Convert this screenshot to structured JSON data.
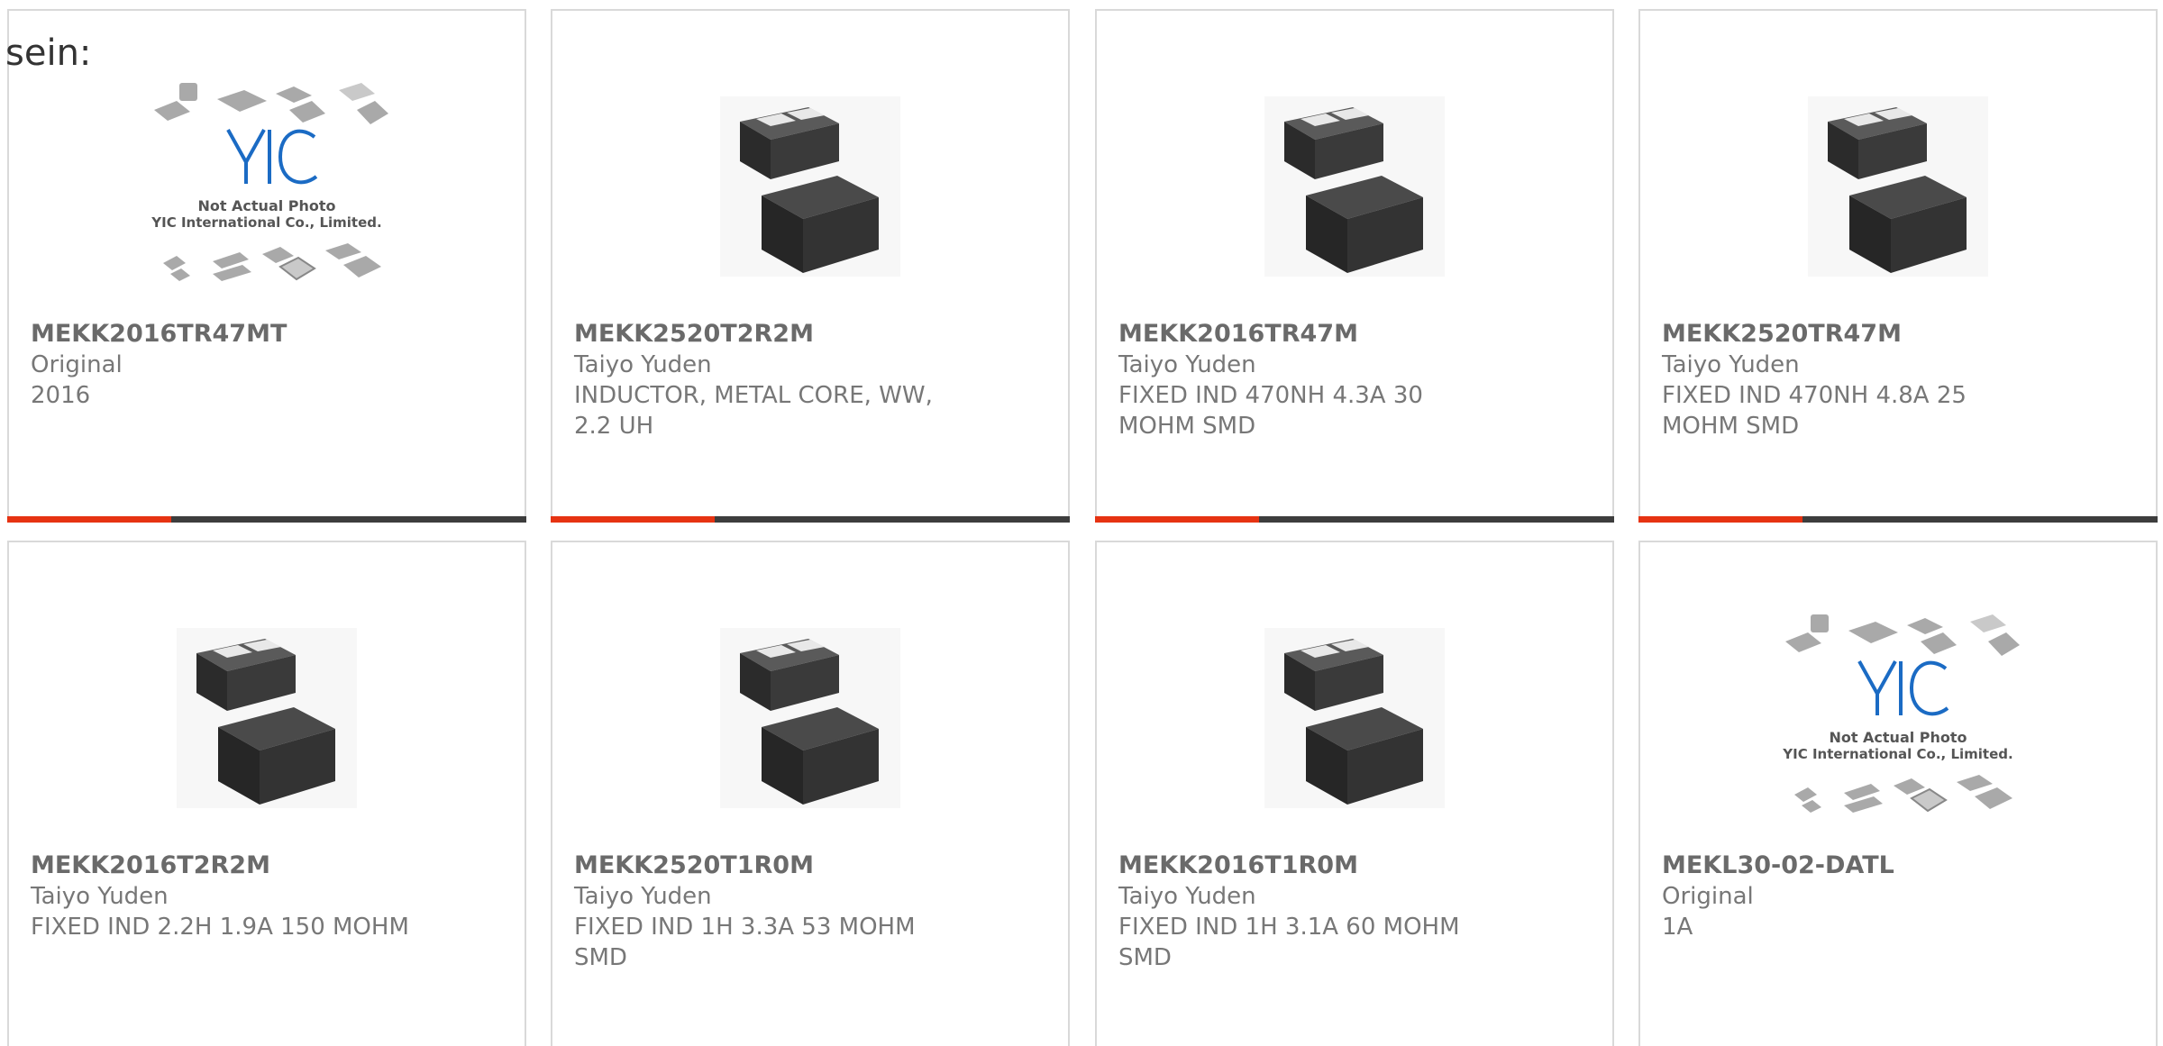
{
  "intro_text": "sein:",
  "colors": {
    "accent": "#e63312",
    "bar": "#3d3d3d"
  },
  "placeholder": {
    "line1": "Not Actual Photo",
    "line2": "YIC International Co., Limited.",
    "logo": "YIC"
  },
  "products": [
    {
      "part": "MEKK2016TR47MT",
      "maker": "Original",
      "desc": "2016",
      "image": "placeholder"
    },
    {
      "part": "MEKK2520T2R2M",
      "maker": "Taiyo Yuden",
      "desc": "INDUCTOR, METAL CORE, WW, 2.2 UH",
      "image": "inductor"
    },
    {
      "part": "MEKK2016TR47M",
      "maker": "Taiyo Yuden",
      "desc": "FIXED IND 470NH 4.3A 30 MOHM SMD",
      "image": "inductor"
    },
    {
      "part": "MEKK2520TR47M",
      "maker": "Taiyo Yuden",
      "desc": "FIXED IND 470NH 4.8A 25 MOHM SMD",
      "image": "inductor"
    },
    {
      "part": "MEKK2016T2R2M",
      "maker": "Taiyo Yuden",
      "desc": "FIXED IND 2.2H 1.9A 150 MOHM",
      "image": "inductor"
    },
    {
      "part": "MEKK2520T1R0M",
      "maker": "Taiyo Yuden",
      "desc": "FIXED IND 1H 3.3A 53 MOHM SMD",
      "image": "inductor"
    },
    {
      "part": "MEKK2016T1R0M",
      "maker": "Taiyo Yuden",
      "desc": "FIXED IND 1H 3.1A 60 MOHM SMD",
      "image": "inductor"
    },
    {
      "part": "MEKL30-02-DATL",
      "maker": "Original",
      "desc": "1A",
      "image": "placeholder"
    }
  ]
}
